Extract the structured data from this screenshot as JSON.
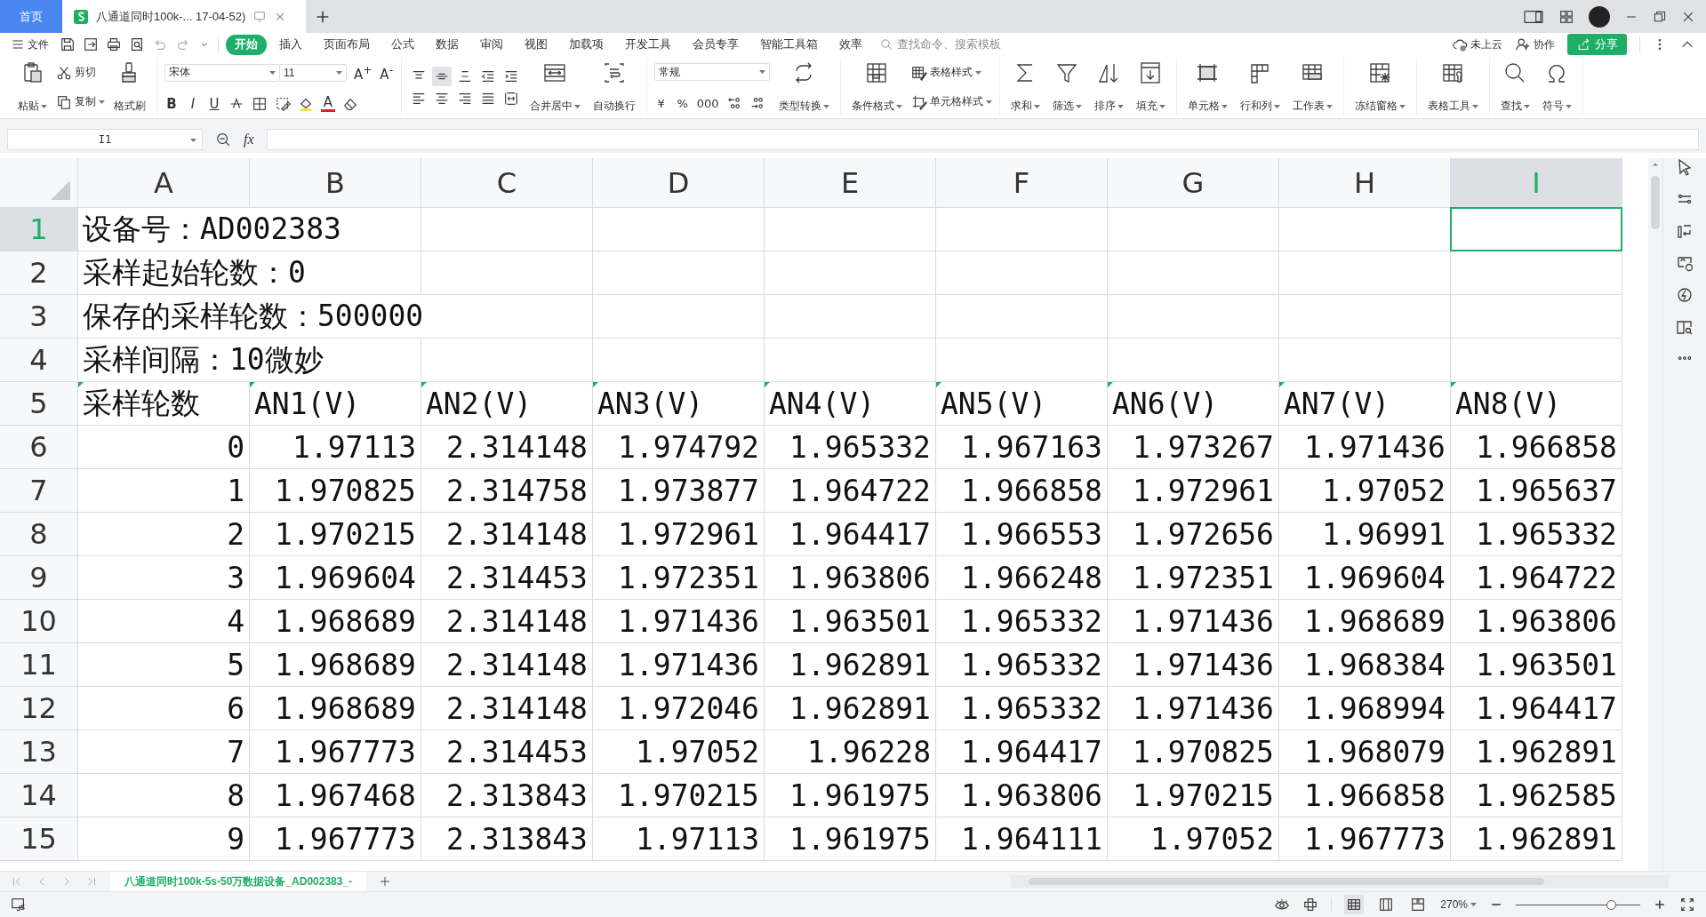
{
  "title_bar": {
    "tabs": [
      {
        "label": "首页",
        "kind": "home",
        "selected": false
      },
      {
        "label": "八通道同时100k-... 17-04-52)",
        "kind": "document",
        "selected": true
      }
    ]
  },
  "menu": {
    "file": "文件",
    "tabs": [
      {
        "label": "开始",
        "selected": true
      },
      {
        "label": "插入",
        "selected": false
      },
      {
        "label": "页面布局",
        "selected": false
      },
      {
        "label": "公式",
        "selected": false
      },
      {
        "label": "数据",
        "selected": false
      },
      {
        "label": "审阅",
        "selected": false
      },
      {
        "label": "视图",
        "selected": false
      },
      {
        "label": "加载项",
        "selected": false
      },
      {
        "label": "开发工具",
        "selected": false
      },
      {
        "label": "会员专享",
        "selected": false
      },
      {
        "label": "智能工具箱",
        "selected": false
      },
      {
        "label": "效率",
        "selected": false
      }
    ],
    "search": {
      "placeholder": "查找命令、搜索模板"
    },
    "cloud": "未上云",
    "collaborate": "协作",
    "share": "分享"
  },
  "ribbon": [
    {
      "items": [
        {
          "kind": "large",
          "label": "粘贴",
          "dropdown": true
        },
        {
          "kind": "stack",
          "items": [
            {
              "label": "剪切",
              "dropdown": false
            },
            {
              "label": "复制",
              "dropdown": true
            }
          ]
        },
        {
          "kind": "large",
          "label": "格式刷",
          "dropdown": false
        }
      ]
    },
    {
      "items": [
        {
          "kind": "font",
          "font": "宋体",
          "size": "11",
          "grow": "A$^{+}$",
          "shrink": "A$^{-}$",
          "styles": [
            "B",
            "I",
            "U"
          ],
          "color_letter": "A"
        }
      ]
    },
    {
      "items": [
        {
          "kind": "align",
          "buttons": [
            {
              "selected": false
            },
            {
              "selected": true
            },
            {
              "selected": false
            },
            {
              "selected": false
            },
            {
              "selected": false
            },
            {
              "selected": false
            },
            {
              "selected": false
            },
            {
              "selected": false
            },
            {
              "selected": false
            },
            {
              "selected": false
            }
          ]
        },
        {
          "kind": "large",
          "label": "合并居中",
          "dropdown": true
        },
        {
          "kind": "large",
          "label": "自动换行",
          "dropdown": false
        }
      ]
    },
    {
      "items": [
        {
          "kind": "number",
          "format": "常规",
          "symbols": [
            "¥",
            "%",
            "000"
          ]
        },
        {
          "kind": "large",
          "label": "类型转换",
          "dropdown": true
        }
      ]
    },
    {
      "items": [
        {
          "kind": "large",
          "label": "条件格式",
          "dropdown": true
        },
        {
          "kind": "stack",
          "items": [
            {
              "label": "表格样式",
              "dropdown": true
            },
            {
              "label": "单元格样式",
              "dropdown": true
            }
          ]
        }
      ]
    },
    {
      "items": [
        {
          "kind": "large",
          "label": "求和",
          "dropdown": true
        },
        {
          "kind": "large",
          "label": "筛选",
          "dropdown": true
        },
        {
          "kind": "large",
          "label": "排序",
          "dropdown": true
        },
        {
          "kind": "large",
          "label": "填充",
          "dropdown": true
        }
      ]
    },
    {
      "items": [
        {
          "kind": "large",
          "label": "单元格",
          "dropdown": true
        },
        {
          "kind": "large",
          "label": "行和列",
          "dropdown": true
        },
        {
          "kind": "large",
          "label": "工作表",
          "dropdown": true
        }
      ]
    },
    {
      "items": [
        {
          "kind": "large",
          "label": "冻结窗格",
          "dropdown": true
        }
      ]
    },
    {
      "items": [
        {
          "kind": "large",
          "label": "表格工具",
          "dropdown": true
        }
      ]
    },
    {
      "items": [
        {
          "kind": "large",
          "label": "查找",
          "dropdown": true
        },
        {
          "kind": "large",
          "label": "符号",
          "dropdown": true
        }
      ]
    }
  ],
  "formula_bar": {
    "name_box": "I1",
    "function_label": "fx"
  },
  "sheet": {
    "columns": [
      {
        "label": "A",
        "selected": false
      },
      {
        "label": "B",
        "selected": false
      },
      {
        "label": "C",
        "selected": false
      },
      {
        "label": "D",
        "selected": false
      },
      {
        "label": "E",
        "selected": false
      },
      {
        "label": "F",
        "selected": false
      },
      {
        "label": "G",
        "selected": false
      },
      {
        "label": "H",
        "selected": false
      },
      {
        "label": "I",
        "selected": true
      }
    ],
    "rows": [
      {
        "header": "1",
        "selected": true,
        "kind": "note",
        "text": "设备号：AD002383"
      },
      {
        "header": "2",
        "selected": false,
        "kind": "note",
        "text": "采样起始轮数：0"
      },
      {
        "header": "3",
        "selected": false,
        "kind": "note",
        "text": "保存的采样轮数：500000"
      },
      {
        "header": "4",
        "selected": false,
        "kind": "note",
        "text": "采样间隔：10微妙"
      },
      {
        "header": "5",
        "selected": false,
        "kind": "header",
        "flagged": true,
        "cells": [
          "采样轮数",
          "AN1(V)",
          "AN2(V)",
          "AN3(V)",
          "AN4(V)",
          "AN5(V)",
          "AN6(V)",
          "AN7(V)",
          "AN8(V)"
        ]
      },
      {
        "header": "6",
        "selected": false,
        "kind": "data",
        "cells": [
          "0",
          "1.97113",
          "2.314148",
          "1.974792",
          "1.965332",
          "1.967163",
          "1.973267",
          "1.971436",
          "1.966858"
        ]
      },
      {
        "header": "7",
        "selected": false,
        "kind": "data",
        "cells": [
          "1",
          "1.970825",
          "2.314758",
          "1.973877",
          "1.964722",
          "1.966858",
          "1.972961",
          "1.97052",
          "1.965637"
        ]
      },
      {
        "header": "8",
        "selected": false,
        "kind": "data",
        "cells": [
          "2",
          "1.970215",
          "2.314148",
          "1.972961",
          "1.964417",
          "1.966553",
          "1.972656",
          "1.96991",
          "1.965332"
        ]
      },
      {
        "header": "9",
        "selected": false,
        "kind": "data",
        "cells": [
          "3",
          "1.969604",
          "2.314453",
          "1.972351",
          "1.963806",
          "1.966248",
          "1.972351",
          "1.969604",
          "1.964722"
        ]
      },
      {
        "header": "10",
        "selected": false,
        "kind": "data",
        "cells": [
          "4",
          "1.968689",
          "2.314148",
          "1.971436",
          "1.963501",
          "1.965332",
          "1.971436",
          "1.968689",
          "1.963806"
        ]
      },
      {
        "header": "11",
        "selected": false,
        "kind": "data",
        "cells": [
          "5",
          "1.968689",
          "2.314148",
          "1.971436",
          "1.962891",
          "1.965332",
          "1.971436",
          "1.968384",
          "1.963501"
        ]
      },
      {
        "header": "12",
        "selected": false,
        "kind": "data",
        "cells": [
          "6",
          "1.968689",
          "2.314148",
          "1.972046",
          "1.962891",
          "1.965332",
          "1.971436",
          "1.968994",
          "1.964417"
        ]
      },
      {
        "header": "13",
        "selected": false,
        "kind": "data",
        "cells": [
          "7",
          "1.967773",
          "2.314453",
          "1.97052",
          "1.96228",
          "1.964417",
          "1.970825",
          "1.968079",
          "1.962891"
        ]
      },
      {
        "header": "14",
        "selected": false,
        "kind": "data",
        "cells": [
          "8",
          "1.967468",
          "2.313843",
          "1.970215",
          "1.961975",
          "1.963806",
          "1.970215",
          "1.966858",
          "1.962585"
        ]
      },
      {
        "header": "15",
        "selected": false,
        "kind": "data",
        "cells": [
          "9",
          "1.967773",
          "2.313843",
          "1.97113",
          "1.961975",
          "1.964111",
          "1.97052",
          "1.967773",
          "1.962891"
        ]
      }
    ]
  },
  "sheet_tabs": [
    {
      "label": "八通道同时100k-5s-50万数据设备_AD002383_-",
      "selected": true
    }
  ],
  "status_bar": {
    "zoom": "270%",
    "zoom_slider": {
      "level": 0.77
    }
  }
}
